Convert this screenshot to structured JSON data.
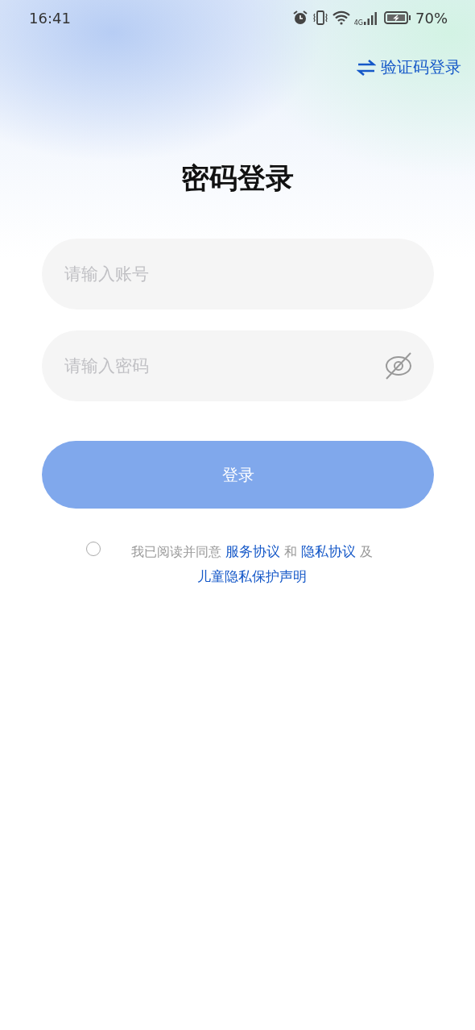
{
  "status_bar": {
    "time": "16:41",
    "network": "4G",
    "battery": "70%"
  },
  "switch_link": {
    "label": "验证码登录"
  },
  "title": "密码登录",
  "fields": [
    {
      "kind": "text",
      "placeholder": "请输入账号"
    },
    {
      "kind": "password",
      "placeholder": "请输入密码",
      "visible": false
    }
  ],
  "login_button": {
    "label": "登录",
    "disabled": true
  },
  "agreement": {
    "checked": false,
    "parts": [
      {
        "kind": "text",
        "text": "我已阅读并同意 "
      },
      {
        "kind": "link",
        "text": "服务协议"
      },
      {
        "kind": "text",
        "text": " 和 "
      },
      {
        "kind": "link",
        "text": "隐私协议"
      },
      {
        "kind": "text",
        "text": " 及 "
      },
      {
        "kind": "link",
        "text": "儿童隐私保护声明"
      }
    ]
  }
}
